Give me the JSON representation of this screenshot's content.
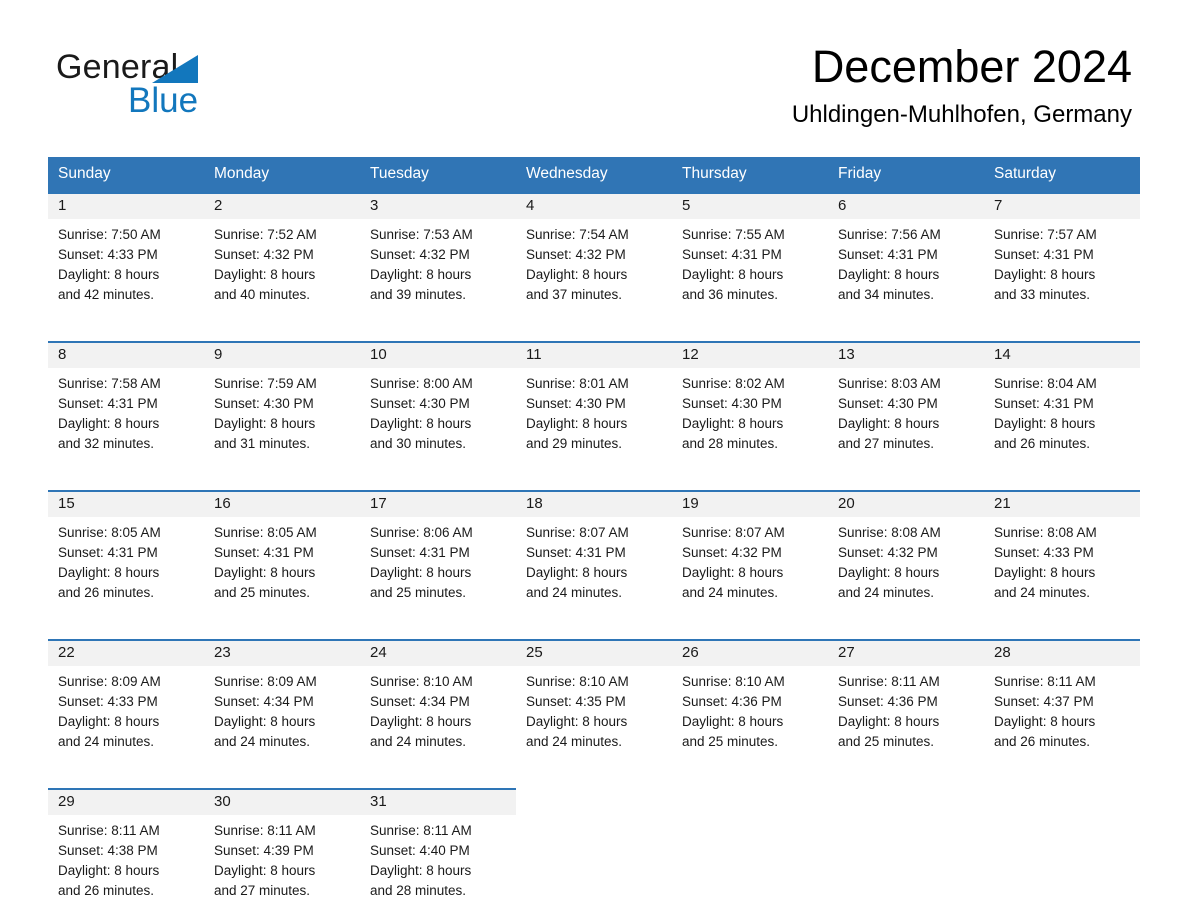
{
  "logo": {
    "word1": "General",
    "word2": "Blue",
    "accent_color": "#1277bd"
  },
  "header": {
    "title": "December 2024",
    "location": "Uhldingen-Muhlhofen, Germany"
  },
  "theme": {
    "header_blue": "#3075b5",
    "divider_blue": "#2e75b6",
    "daynum_band": "#f2f2f2",
    "text": "#1a1a1a"
  },
  "weekday_headers": [
    "Sunday",
    "Monday",
    "Tuesday",
    "Wednesday",
    "Thursday",
    "Friday",
    "Saturday"
  ],
  "weeks": [
    [
      {
        "day": "1",
        "sunrise": "Sunrise: 7:50 AM",
        "sunset": "Sunset: 4:33 PM",
        "daylight1": "Daylight: 8 hours",
        "daylight2": "and 42 minutes."
      },
      {
        "day": "2",
        "sunrise": "Sunrise: 7:52 AM",
        "sunset": "Sunset: 4:32 PM",
        "daylight1": "Daylight: 8 hours",
        "daylight2": "and 40 minutes."
      },
      {
        "day": "3",
        "sunrise": "Sunrise: 7:53 AM",
        "sunset": "Sunset: 4:32 PM",
        "daylight1": "Daylight: 8 hours",
        "daylight2": "and 39 minutes."
      },
      {
        "day": "4",
        "sunrise": "Sunrise: 7:54 AM",
        "sunset": "Sunset: 4:32 PM",
        "daylight1": "Daylight: 8 hours",
        "daylight2": "and 37 minutes."
      },
      {
        "day": "5",
        "sunrise": "Sunrise: 7:55 AM",
        "sunset": "Sunset: 4:31 PM",
        "daylight1": "Daylight: 8 hours",
        "daylight2": "and 36 minutes."
      },
      {
        "day": "6",
        "sunrise": "Sunrise: 7:56 AM",
        "sunset": "Sunset: 4:31 PM",
        "daylight1": "Daylight: 8 hours",
        "daylight2": "and 34 minutes."
      },
      {
        "day": "7",
        "sunrise": "Sunrise: 7:57 AM",
        "sunset": "Sunset: 4:31 PM",
        "daylight1": "Daylight: 8 hours",
        "daylight2": "and 33 minutes."
      }
    ],
    [
      {
        "day": "8",
        "sunrise": "Sunrise: 7:58 AM",
        "sunset": "Sunset: 4:31 PM",
        "daylight1": "Daylight: 8 hours",
        "daylight2": "and 32 minutes."
      },
      {
        "day": "9",
        "sunrise": "Sunrise: 7:59 AM",
        "sunset": "Sunset: 4:30 PM",
        "daylight1": "Daylight: 8 hours",
        "daylight2": "and 31 minutes."
      },
      {
        "day": "10",
        "sunrise": "Sunrise: 8:00 AM",
        "sunset": "Sunset: 4:30 PM",
        "daylight1": "Daylight: 8 hours",
        "daylight2": "and 30 minutes."
      },
      {
        "day": "11",
        "sunrise": "Sunrise: 8:01 AM",
        "sunset": "Sunset: 4:30 PM",
        "daylight1": "Daylight: 8 hours",
        "daylight2": "and 29 minutes."
      },
      {
        "day": "12",
        "sunrise": "Sunrise: 8:02 AM",
        "sunset": "Sunset: 4:30 PM",
        "daylight1": "Daylight: 8 hours",
        "daylight2": "and 28 minutes."
      },
      {
        "day": "13",
        "sunrise": "Sunrise: 8:03 AM",
        "sunset": "Sunset: 4:30 PM",
        "daylight1": "Daylight: 8 hours",
        "daylight2": "and 27 minutes."
      },
      {
        "day": "14",
        "sunrise": "Sunrise: 8:04 AM",
        "sunset": "Sunset: 4:31 PM",
        "daylight1": "Daylight: 8 hours",
        "daylight2": "and 26 minutes."
      }
    ],
    [
      {
        "day": "15",
        "sunrise": "Sunrise: 8:05 AM",
        "sunset": "Sunset: 4:31 PM",
        "daylight1": "Daylight: 8 hours",
        "daylight2": "and 26 minutes."
      },
      {
        "day": "16",
        "sunrise": "Sunrise: 8:05 AM",
        "sunset": "Sunset: 4:31 PM",
        "daylight1": "Daylight: 8 hours",
        "daylight2": "and 25 minutes."
      },
      {
        "day": "17",
        "sunrise": "Sunrise: 8:06 AM",
        "sunset": "Sunset: 4:31 PM",
        "daylight1": "Daylight: 8 hours",
        "daylight2": "and 25 minutes."
      },
      {
        "day": "18",
        "sunrise": "Sunrise: 8:07 AM",
        "sunset": "Sunset: 4:31 PM",
        "daylight1": "Daylight: 8 hours",
        "daylight2": "and 24 minutes."
      },
      {
        "day": "19",
        "sunrise": "Sunrise: 8:07 AM",
        "sunset": "Sunset: 4:32 PM",
        "daylight1": "Daylight: 8 hours",
        "daylight2": "and 24 minutes."
      },
      {
        "day": "20",
        "sunrise": "Sunrise: 8:08 AM",
        "sunset": "Sunset: 4:32 PM",
        "daylight1": "Daylight: 8 hours",
        "daylight2": "and 24 minutes."
      },
      {
        "day": "21",
        "sunrise": "Sunrise: 8:08 AM",
        "sunset": "Sunset: 4:33 PM",
        "daylight1": "Daylight: 8 hours",
        "daylight2": "and 24 minutes."
      }
    ],
    [
      {
        "day": "22",
        "sunrise": "Sunrise: 8:09 AM",
        "sunset": "Sunset: 4:33 PM",
        "daylight1": "Daylight: 8 hours",
        "daylight2": "and 24 minutes."
      },
      {
        "day": "23",
        "sunrise": "Sunrise: 8:09 AM",
        "sunset": "Sunset: 4:34 PM",
        "daylight1": "Daylight: 8 hours",
        "daylight2": "and 24 minutes."
      },
      {
        "day": "24",
        "sunrise": "Sunrise: 8:10 AM",
        "sunset": "Sunset: 4:34 PM",
        "daylight1": "Daylight: 8 hours",
        "daylight2": "and 24 minutes."
      },
      {
        "day": "25",
        "sunrise": "Sunrise: 8:10 AM",
        "sunset": "Sunset: 4:35 PM",
        "daylight1": "Daylight: 8 hours",
        "daylight2": "and 24 minutes."
      },
      {
        "day": "26",
        "sunrise": "Sunrise: 8:10 AM",
        "sunset": "Sunset: 4:36 PM",
        "daylight1": "Daylight: 8 hours",
        "daylight2": "and 25 minutes."
      },
      {
        "day": "27",
        "sunrise": "Sunrise: 8:11 AM",
        "sunset": "Sunset: 4:36 PM",
        "daylight1": "Daylight: 8 hours",
        "daylight2": "and 25 minutes."
      },
      {
        "day": "28",
        "sunrise": "Sunrise: 8:11 AM",
        "sunset": "Sunset: 4:37 PM",
        "daylight1": "Daylight: 8 hours",
        "daylight2": "and 26 minutes."
      }
    ],
    [
      {
        "day": "29",
        "sunrise": "Sunrise: 8:11 AM",
        "sunset": "Sunset: 4:38 PM",
        "daylight1": "Daylight: 8 hours",
        "daylight2": "and 26 minutes."
      },
      {
        "day": "30",
        "sunrise": "Sunrise: 8:11 AM",
        "sunset": "Sunset: 4:39 PM",
        "daylight1": "Daylight: 8 hours",
        "daylight2": "and 27 minutes."
      },
      {
        "day": "31",
        "sunrise": "Sunrise: 8:11 AM",
        "sunset": "Sunset: 4:40 PM",
        "daylight1": "Daylight: 8 hours",
        "daylight2": "and 28 minutes."
      },
      {
        "day": "",
        "sunrise": "",
        "sunset": "",
        "daylight1": "",
        "daylight2": ""
      },
      {
        "day": "",
        "sunrise": "",
        "sunset": "",
        "daylight1": "",
        "daylight2": ""
      },
      {
        "day": "",
        "sunrise": "",
        "sunset": "",
        "daylight1": "",
        "daylight2": ""
      },
      {
        "day": "",
        "sunrise": "",
        "sunset": "",
        "daylight1": "",
        "daylight2": ""
      }
    ]
  ]
}
